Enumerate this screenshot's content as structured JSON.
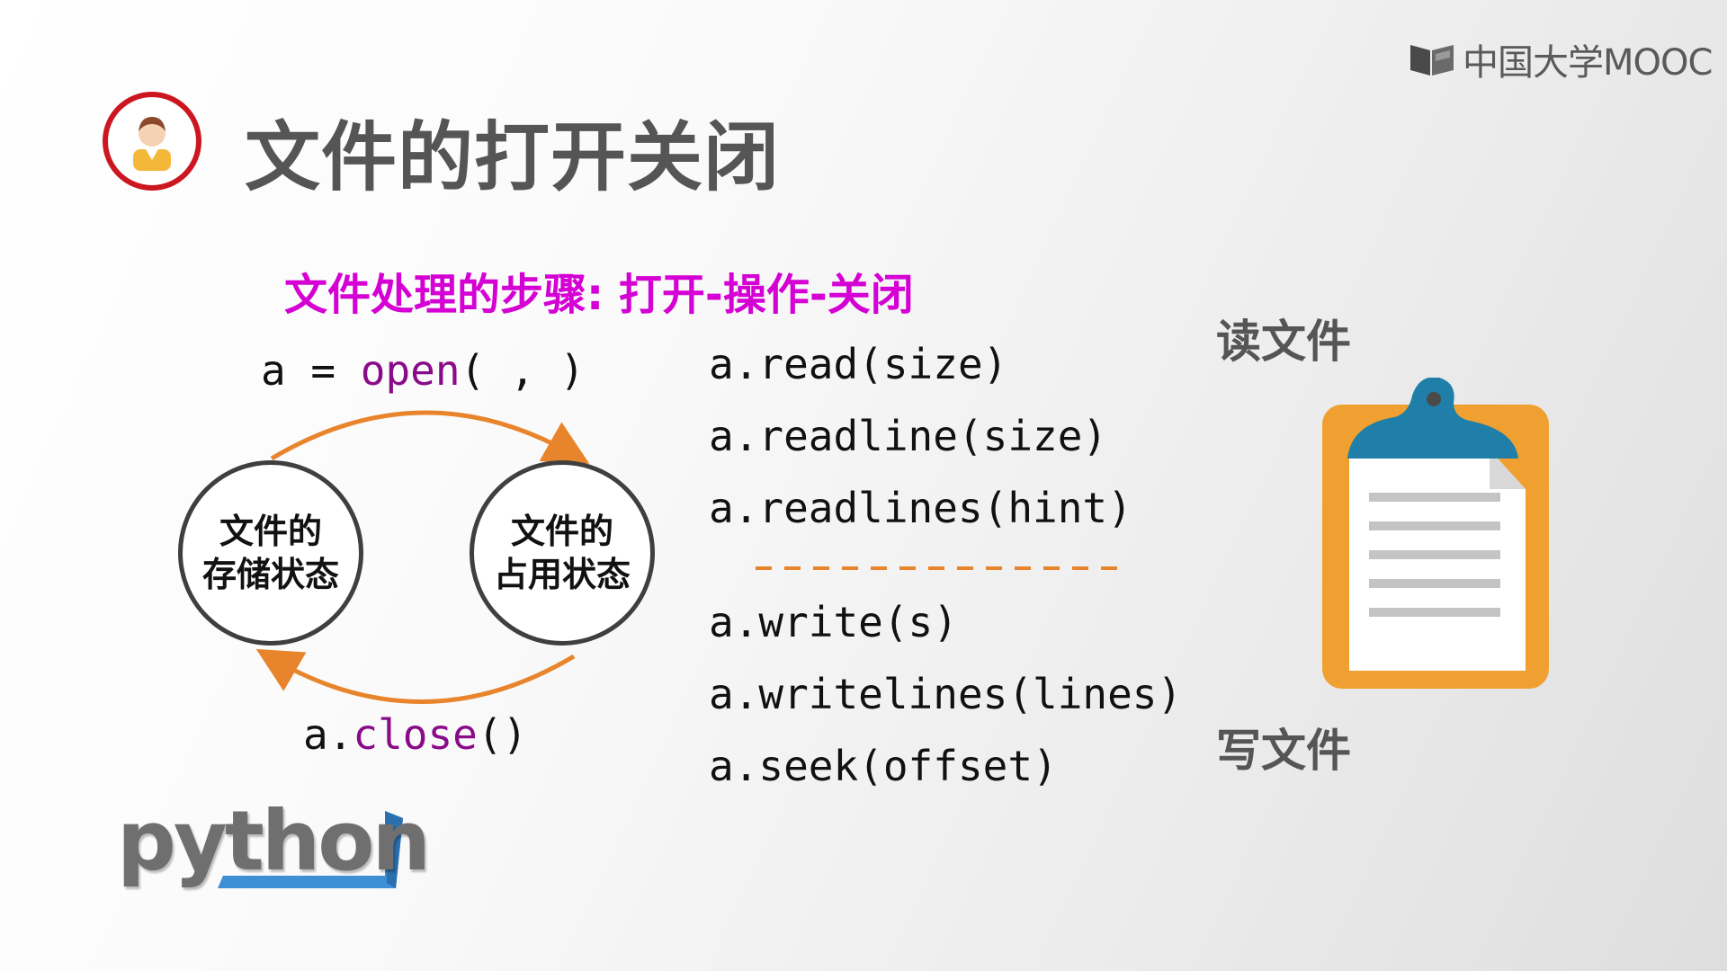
{
  "brand": {
    "logo_text": "中国大学MOOC"
  },
  "slide": {
    "title": "文件的打开关闭",
    "subtitle": "文件处理的步骤: 打开-操作-关闭"
  },
  "cycle": {
    "open_var": "a = ",
    "open_fn": "open",
    "open_args": "( , )",
    "close_obj": "a.",
    "close_fn": "close",
    "close_args": "()",
    "state_storage": [
      "文件的",
      "存储状态"
    ],
    "state_occupy": [
      "文件的",
      "占用状态"
    ]
  },
  "methods": {
    "read": [
      "a.read(size)",
      "a.readline(size)",
      "a.readlines(hint)"
    ],
    "write": [
      "a.write(s)",
      "a.writelines(lines)",
      "a.seek(offset)"
    ]
  },
  "labels": {
    "read": "读文件",
    "write": "写文件"
  },
  "python_logo": "python",
  "colors": {
    "accent_magenta": "#d400d4",
    "arrow_orange": "#e8852c",
    "keyword_purple": "#8a0b8a",
    "avatar_ring": "#cc1620",
    "clipboard_orange": "#f0a030",
    "clipboard_clip": "#1f7fa8"
  },
  "icons": [
    "mooc-logo-icon",
    "teacher-avatar-icon",
    "clipboard-icon",
    "python-logo-icon"
  ]
}
